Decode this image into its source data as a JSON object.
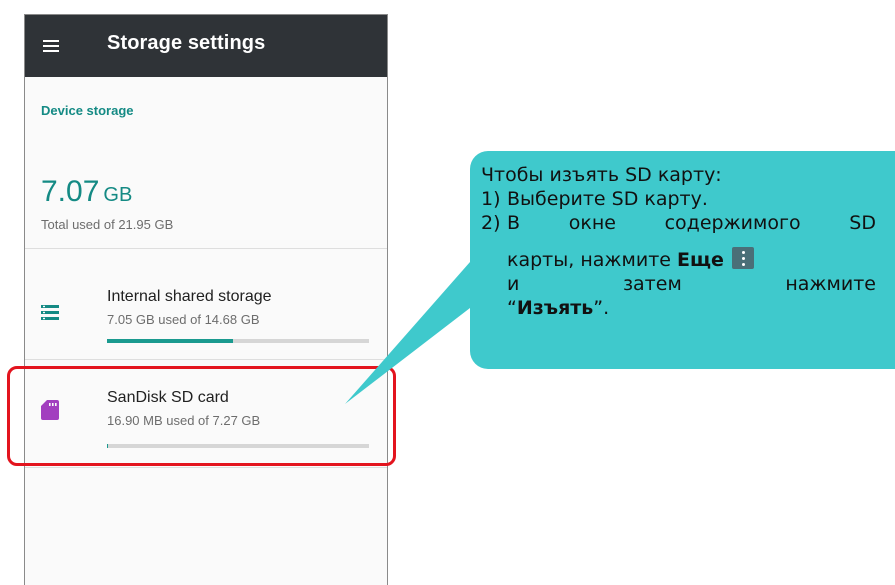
{
  "appbar": {
    "title": "Storage settings",
    "menu_icon": "hamburger-menu-icon"
  },
  "device_storage": {
    "section_title": "Device storage",
    "total_value": "7.07",
    "total_unit": "GB",
    "total_sub": "Total used of 21.95 GB"
  },
  "items": [
    {
      "title": "Internal shared storage",
      "subtitle": "7.05 GB used of 14.68 GB",
      "icon": "storage-list-icon",
      "usage_fraction": 0.48,
      "bar_color": "#1a9a8f"
    },
    {
      "title": "SanDisk SD card",
      "subtitle": "16.90 MB used of 7.27 GB",
      "icon": "sd-card-icon",
      "usage_fraction": 0.002,
      "bar_color": "#1a9a8f"
    }
  ],
  "callout": {
    "heading": "Чтобы изъять SD карту:",
    "step1_num": "1)",
    "step1_text": "Выберите SD карту.",
    "step2_num": "2)",
    "step2_words": [
      "В",
      "окне",
      "содержимого",
      "SD"
    ],
    "step2_line2_prefix": "карты, нажмите ",
    "step2_bold_more": "Еще",
    "step2_line3_words": [
      "и",
      "затем",
      "нажмите"
    ],
    "step2_quote_open": "“",
    "step2_bold_eject": "Изъять",
    "step2_quote_close": "”.",
    "more_icon": "overflow-menu-icon"
  },
  "colors": {
    "accent": "#148a84",
    "appbar": "#2f3337",
    "highlight": "#e3141e",
    "bubble": "#3fc9cc",
    "sd_icon": "#a23fbf"
  }
}
